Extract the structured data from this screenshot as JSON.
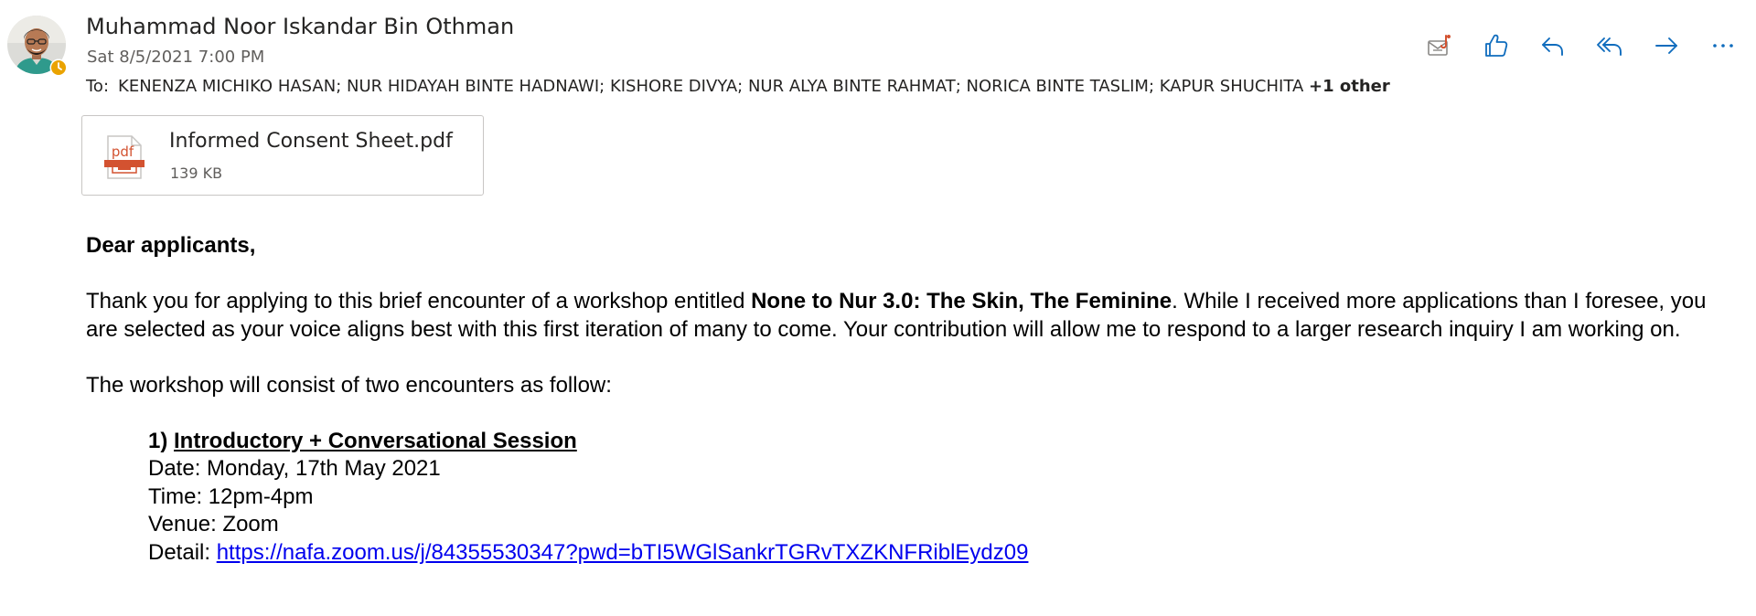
{
  "header": {
    "sender_name": "Muhammad Noor Iskandar Bin Othman",
    "date": "Sat 8/5/2021 7:00 PM",
    "to_label": "To:",
    "recipients": "KENENZA MICHIKO HASAN; NUR HIDAYAH BINTE HADNAWI; KISHORE DIVYA; NUR ALYA BINTE RAHMAT; NORICA BINTE TASLIM; KAPUR SHUCHITA",
    "more_recipients": "+1 other",
    "avatar_icon": "avatar-photo",
    "presence_icon": "away-clock-icon"
  },
  "toolbar": {
    "items": [
      "summary-icon",
      "like-icon",
      "reply-icon",
      "reply-all-icon",
      "forward-icon",
      "more-icon"
    ],
    "accent": "#0f6cbd"
  },
  "attachment": {
    "name": "Informed Consent Sheet.pdf",
    "size": "139 KB",
    "type_label": "pdf",
    "color": "#d35230"
  },
  "body": {
    "greeting": "Dear applicants,",
    "p1_a": "Thank you for applying to this brief encounter of a workshop entitled ",
    "p1_bold": "None to Nur 3.0: The Skin, The Feminine",
    "p1_b": ". While I received more applications than I foresee, you are selected as your voice aligns best with this first iteration of many to come. Your contribution will allow me to respond to a larger research inquiry I am working on.",
    "p2": "The workshop will consist of two encounters as follow:",
    "session": {
      "number": "1)",
      "title": "Introductory + Conversational Session",
      "date": "Date: Monday, 17th May 2021",
      "time": "Time: 12pm-4pm",
      "venue": "Venue: Zoom",
      "detail_label": "Detail:",
      "detail_link": "https://nafa.zoom.us/j/84355530347?pwd=bTI5WGlSankrTGRvTXZKNFRiblEydz09"
    }
  }
}
